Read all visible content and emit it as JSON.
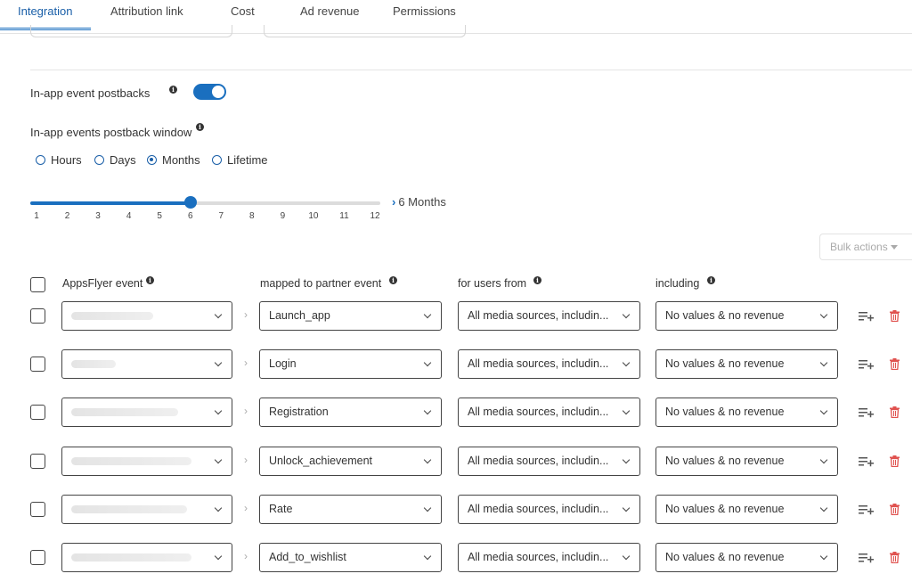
{
  "tabs": [
    {
      "label": "Integration",
      "active": true
    },
    {
      "label": "Attribution link",
      "active": false
    },
    {
      "label": "Cost",
      "active": false
    },
    {
      "label": "Ad revenue",
      "active": false
    },
    {
      "label": "Permissions",
      "active": false
    }
  ],
  "postbacks": {
    "toggle_label": "In-app event postbacks",
    "toggle_on": true,
    "window_label": "In-app events postback window",
    "radio_options": [
      "Hours",
      "Days",
      "Months",
      "Lifetime"
    ],
    "selected_option": "Months",
    "slider": {
      "ticks": [
        "1",
        "2",
        "3",
        "4",
        "5",
        "6",
        "7",
        "8",
        "9",
        "10",
        "11",
        "12"
      ],
      "value": 6,
      "value_label": "6 Months"
    }
  },
  "bulk_actions": "Bulk actions",
  "table": {
    "headers": {
      "appsflyer_event": "AppsFlyer event",
      "partner_event": "mapped to partner event",
      "users_from": "for users from",
      "including": "including"
    },
    "separator": "›",
    "rows": [
      {
        "partner_event": "Launch_app",
        "users_from": "All media sources, includin...",
        "including": "No values & no revenue"
      },
      {
        "partner_event": "Login",
        "users_from": "All media sources, includin...",
        "including": "No values & no revenue"
      },
      {
        "partner_event": "Registration",
        "users_from": "All media sources, includin...",
        "including": "No values & no revenue"
      },
      {
        "partner_event": "Unlock_achievement",
        "users_from": "All media sources, includin...",
        "including": "No values & no revenue"
      },
      {
        "partner_event": "Rate",
        "users_from": "All media sources, includin...",
        "including": "No values & no revenue"
      },
      {
        "partner_event": "Add_to_wishlist",
        "users_from": "All media sources, includin...",
        "including": "No values & no revenue"
      }
    ]
  },
  "icons": {
    "info": "info-icon",
    "add_row": "playlist-add-icon",
    "delete": "trash-icon",
    "dropdown": "chevron-down-icon"
  },
  "colors": {
    "accent": "#1a6fbf",
    "delete": "#e0524f",
    "muted": "#aaaaaa"
  }
}
